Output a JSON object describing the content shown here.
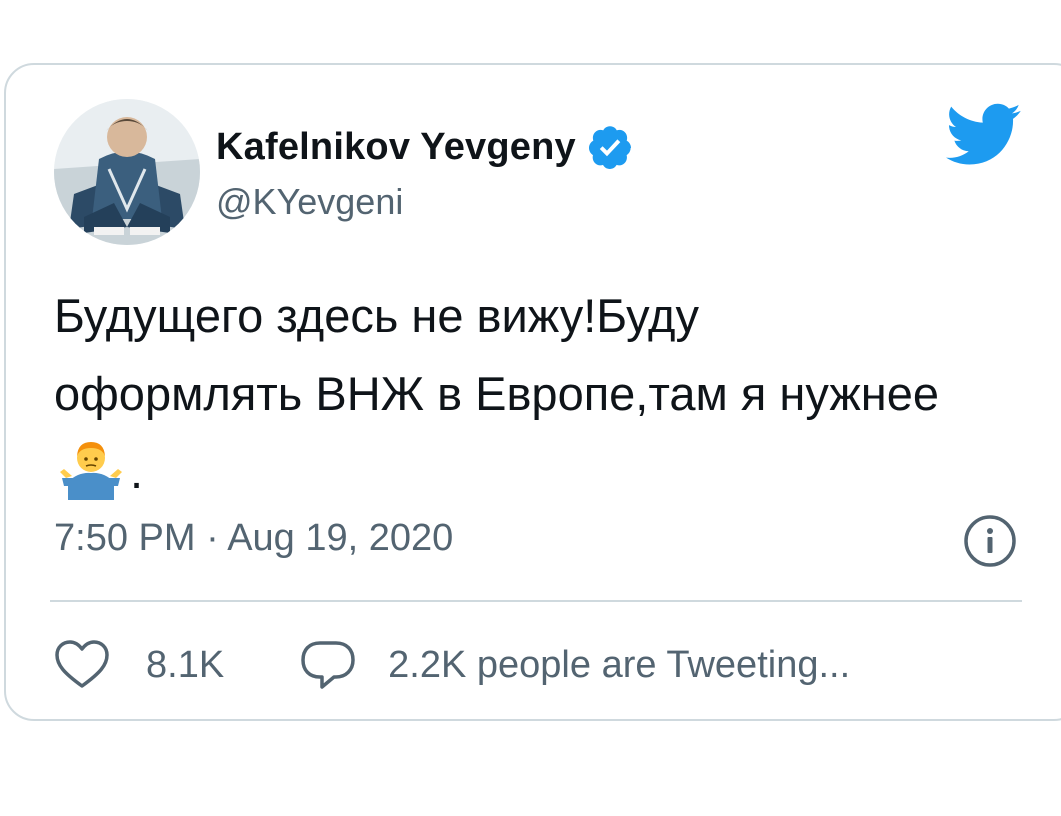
{
  "tweet": {
    "author": {
      "name": "Kafelnikov Yevgeny",
      "handle": "@KYevgeni",
      "verified": true
    },
    "text_part1": "Будущего здесь не вижу!Буду оформлять ВНЖ в Европе,там я нужнее",
    "emoji": "person-shrugging",
    "text_part2": ".",
    "timestamp": "7:50 PM · Aug 19, 2020",
    "likes": "8.1K",
    "conversation": "2.2K people are Tweeting..."
  },
  "icons": {
    "logo": "twitter-bird-icon",
    "verified": "verified-badge-icon",
    "info": "info-icon",
    "like": "heart-icon",
    "reply": "speech-bubble-icon"
  },
  "colors": {
    "brand": "#1d9bf0",
    "text": "#0f1419",
    "secondary": "#536471",
    "border": "#cfd9de"
  }
}
